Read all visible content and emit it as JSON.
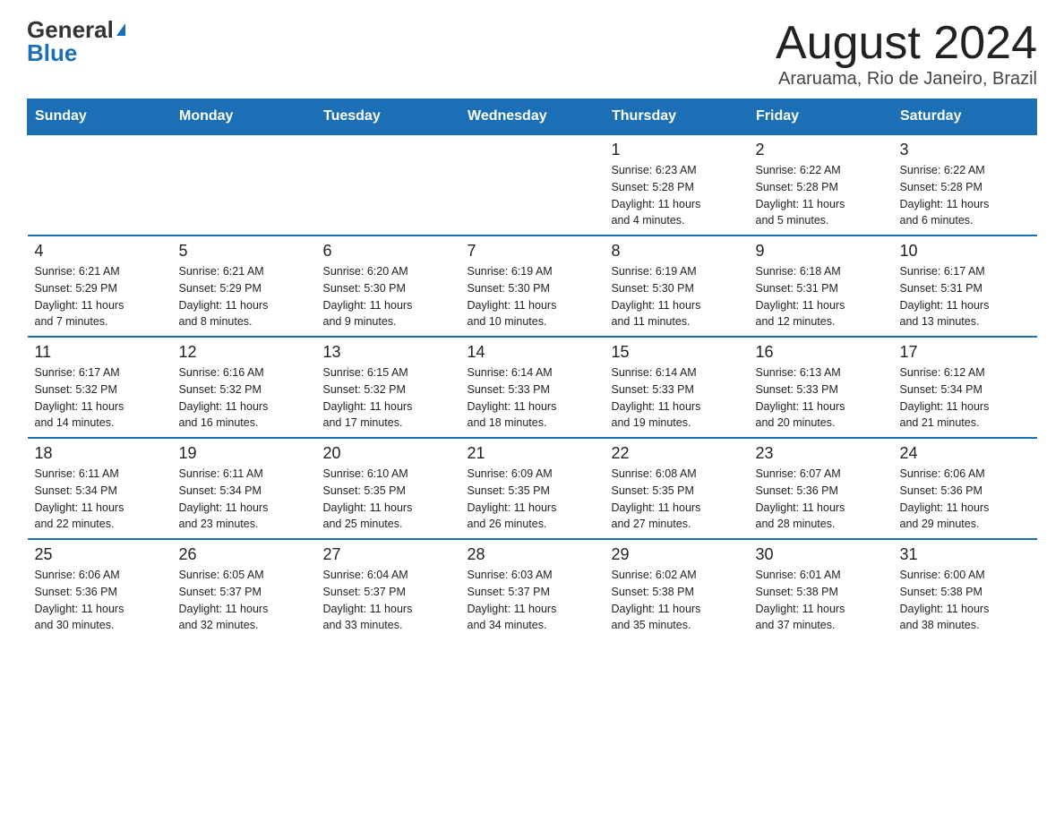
{
  "header": {
    "logo_general": "General",
    "logo_blue": "Blue",
    "title": "August 2024",
    "location": "Araruama, Rio de Janeiro, Brazil"
  },
  "days_of_week": [
    "Sunday",
    "Monday",
    "Tuesday",
    "Wednesday",
    "Thursday",
    "Friday",
    "Saturday"
  ],
  "weeks": [
    [
      {
        "day": "",
        "info": ""
      },
      {
        "day": "",
        "info": ""
      },
      {
        "day": "",
        "info": ""
      },
      {
        "day": "",
        "info": ""
      },
      {
        "day": "1",
        "info": "Sunrise: 6:23 AM\nSunset: 5:28 PM\nDaylight: 11 hours\nand 4 minutes."
      },
      {
        "day": "2",
        "info": "Sunrise: 6:22 AM\nSunset: 5:28 PM\nDaylight: 11 hours\nand 5 minutes."
      },
      {
        "day": "3",
        "info": "Sunrise: 6:22 AM\nSunset: 5:28 PM\nDaylight: 11 hours\nand 6 minutes."
      }
    ],
    [
      {
        "day": "4",
        "info": "Sunrise: 6:21 AM\nSunset: 5:29 PM\nDaylight: 11 hours\nand 7 minutes."
      },
      {
        "day": "5",
        "info": "Sunrise: 6:21 AM\nSunset: 5:29 PM\nDaylight: 11 hours\nand 8 minutes."
      },
      {
        "day": "6",
        "info": "Sunrise: 6:20 AM\nSunset: 5:30 PM\nDaylight: 11 hours\nand 9 minutes."
      },
      {
        "day": "7",
        "info": "Sunrise: 6:19 AM\nSunset: 5:30 PM\nDaylight: 11 hours\nand 10 minutes."
      },
      {
        "day": "8",
        "info": "Sunrise: 6:19 AM\nSunset: 5:30 PM\nDaylight: 11 hours\nand 11 minutes."
      },
      {
        "day": "9",
        "info": "Sunrise: 6:18 AM\nSunset: 5:31 PM\nDaylight: 11 hours\nand 12 minutes."
      },
      {
        "day": "10",
        "info": "Sunrise: 6:17 AM\nSunset: 5:31 PM\nDaylight: 11 hours\nand 13 minutes."
      }
    ],
    [
      {
        "day": "11",
        "info": "Sunrise: 6:17 AM\nSunset: 5:32 PM\nDaylight: 11 hours\nand 14 minutes."
      },
      {
        "day": "12",
        "info": "Sunrise: 6:16 AM\nSunset: 5:32 PM\nDaylight: 11 hours\nand 16 minutes."
      },
      {
        "day": "13",
        "info": "Sunrise: 6:15 AM\nSunset: 5:32 PM\nDaylight: 11 hours\nand 17 minutes."
      },
      {
        "day": "14",
        "info": "Sunrise: 6:14 AM\nSunset: 5:33 PM\nDaylight: 11 hours\nand 18 minutes."
      },
      {
        "day": "15",
        "info": "Sunrise: 6:14 AM\nSunset: 5:33 PM\nDaylight: 11 hours\nand 19 minutes."
      },
      {
        "day": "16",
        "info": "Sunrise: 6:13 AM\nSunset: 5:33 PM\nDaylight: 11 hours\nand 20 minutes."
      },
      {
        "day": "17",
        "info": "Sunrise: 6:12 AM\nSunset: 5:34 PM\nDaylight: 11 hours\nand 21 minutes."
      }
    ],
    [
      {
        "day": "18",
        "info": "Sunrise: 6:11 AM\nSunset: 5:34 PM\nDaylight: 11 hours\nand 22 minutes."
      },
      {
        "day": "19",
        "info": "Sunrise: 6:11 AM\nSunset: 5:34 PM\nDaylight: 11 hours\nand 23 minutes."
      },
      {
        "day": "20",
        "info": "Sunrise: 6:10 AM\nSunset: 5:35 PM\nDaylight: 11 hours\nand 25 minutes."
      },
      {
        "day": "21",
        "info": "Sunrise: 6:09 AM\nSunset: 5:35 PM\nDaylight: 11 hours\nand 26 minutes."
      },
      {
        "day": "22",
        "info": "Sunrise: 6:08 AM\nSunset: 5:35 PM\nDaylight: 11 hours\nand 27 minutes."
      },
      {
        "day": "23",
        "info": "Sunrise: 6:07 AM\nSunset: 5:36 PM\nDaylight: 11 hours\nand 28 minutes."
      },
      {
        "day": "24",
        "info": "Sunrise: 6:06 AM\nSunset: 5:36 PM\nDaylight: 11 hours\nand 29 minutes."
      }
    ],
    [
      {
        "day": "25",
        "info": "Sunrise: 6:06 AM\nSunset: 5:36 PM\nDaylight: 11 hours\nand 30 minutes."
      },
      {
        "day": "26",
        "info": "Sunrise: 6:05 AM\nSunset: 5:37 PM\nDaylight: 11 hours\nand 32 minutes."
      },
      {
        "day": "27",
        "info": "Sunrise: 6:04 AM\nSunset: 5:37 PM\nDaylight: 11 hours\nand 33 minutes."
      },
      {
        "day": "28",
        "info": "Sunrise: 6:03 AM\nSunset: 5:37 PM\nDaylight: 11 hours\nand 34 minutes."
      },
      {
        "day": "29",
        "info": "Sunrise: 6:02 AM\nSunset: 5:38 PM\nDaylight: 11 hours\nand 35 minutes."
      },
      {
        "day": "30",
        "info": "Sunrise: 6:01 AM\nSunset: 5:38 PM\nDaylight: 11 hours\nand 37 minutes."
      },
      {
        "day": "31",
        "info": "Sunrise: 6:00 AM\nSunset: 5:38 PM\nDaylight: 11 hours\nand 38 minutes."
      }
    ]
  ]
}
